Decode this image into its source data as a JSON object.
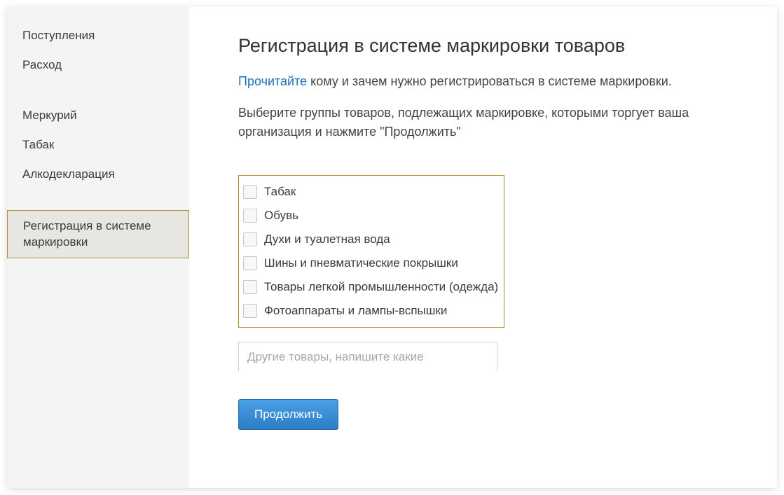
{
  "sidebar": {
    "group1": [
      {
        "label": "Поступления"
      },
      {
        "label": "Расход"
      }
    ],
    "group2": [
      {
        "label": "Меркурий"
      },
      {
        "label": "Табак"
      },
      {
        "label": "Алкодекларация"
      }
    ],
    "group3": [
      {
        "label": "Регистрация в системе маркировки",
        "active": true
      }
    ]
  },
  "main": {
    "title": "Регистрация в системе маркировки товаров",
    "read_link": "Прочитайте",
    "read_rest": " кому и зачем нужно регистрироваться в системе маркировки.",
    "instruction": "Выберите группы товаров, подлежащих маркировке, которыми торгует ваша организация и нажмите \"Продолжить\"",
    "checkboxes": [
      {
        "label": "Табак"
      },
      {
        "label": "Обувь"
      },
      {
        "label": "Духи и туалетная вода"
      },
      {
        "label": "Шины и пневматические покрышки"
      },
      {
        "label": "Товары легкой промышленности (одежда)"
      },
      {
        "label": "Фотоаппараты и лампы-вспышки"
      }
    ],
    "other_placeholder": "Другие товары, напишите какие",
    "continue_label": "Продолжить"
  }
}
